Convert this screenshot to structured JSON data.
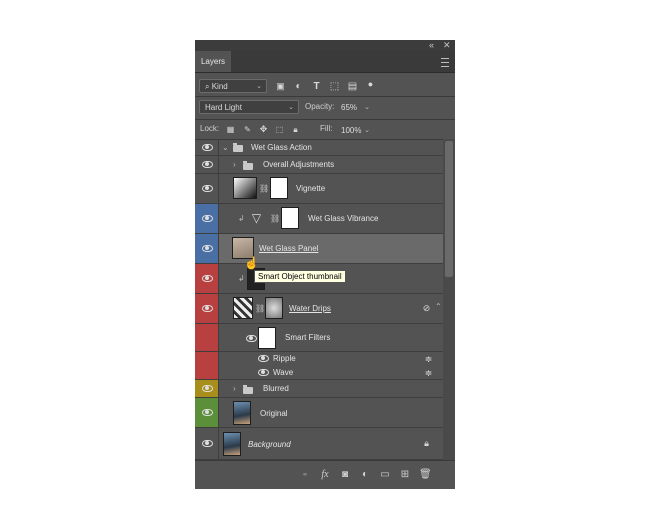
{
  "panel": {
    "title": "Layers",
    "collapse_glyph": "«",
    "close_glyph": "✕",
    "menu_icon": "hamburger-menu-icon"
  },
  "filter": {
    "kind_label": "Kind",
    "icons": [
      "image-filter-icon",
      "adjustment-filter-icon",
      "type-filter-icon",
      "shape-filter-icon",
      "smart-object-filter-icon",
      "filter-toggle-icon"
    ]
  },
  "blend": {
    "mode": "Hard Light",
    "opacity_label": "Opacity:",
    "opacity_value": "65%"
  },
  "lock": {
    "label": "Lock:",
    "fill_label": "Fill:",
    "fill_value": "100%"
  },
  "layers": [
    {
      "name": "Wet Glass Action",
      "type": "group",
      "color": "#535353"
    },
    {
      "name": "Overall Adjustments",
      "type": "group",
      "color": "#535353"
    },
    {
      "name": "Vignette",
      "type": "adjustment",
      "color": "#535353"
    },
    {
      "name": "Wet Glass Vibrance",
      "type": "adjustment",
      "color": "#4a6fa5"
    },
    {
      "name": "Wet Glass Panel",
      "type": "smart-object",
      "color": "#4a6fa5"
    },
    {
      "name": "",
      "type": "smart-object",
      "color": "#b84040"
    },
    {
      "name": "Water Drips",
      "type": "smart-object",
      "color": "#b84040"
    },
    {
      "name": "Smart Filters",
      "type": "smart-filters",
      "color": "#b84040"
    },
    {
      "name": "Ripple",
      "type": "filter",
      "color": "#b84040"
    },
    {
      "name": "Wave",
      "type": "filter",
      "color": "#b84040"
    },
    {
      "name": "Blurred",
      "type": "group",
      "color": "#a88f1c"
    },
    {
      "name": "Original",
      "type": "pixel",
      "color": "#5c8f3a"
    },
    {
      "name": "Background",
      "type": "pixel",
      "color": "#535353"
    }
  ],
  "tooltip": "Smart Object thumbnail",
  "footer_icons": [
    "link-layers-icon",
    "fx-icon",
    "add-mask-icon",
    "new-adjustment-icon",
    "new-group-icon",
    "new-layer-icon",
    "delete-layer-icon"
  ],
  "footer": {
    "fx_label": "fx"
  }
}
